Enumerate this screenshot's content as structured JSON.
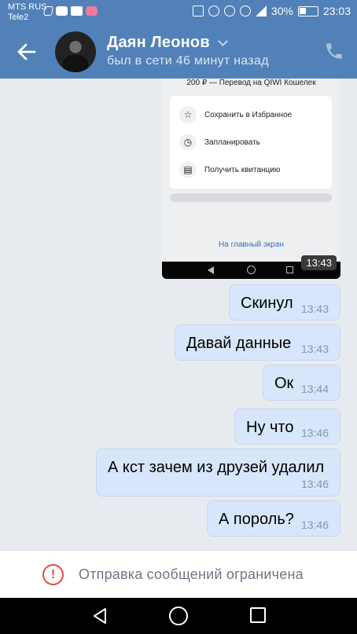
{
  "statusbar": {
    "carrier1": "MTS RUS",
    "carrier2": "Tele2",
    "battery": "30%",
    "time": "23:03"
  },
  "header": {
    "name": "Даян Леонов",
    "last_seen": "был в сети 46 минут назад",
    "back_icon": "arrow-left-icon",
    "call_icon": "phone-icon"
  },
  "screenshot": {
    "title": "200 ₽ — Перевод на QIWI Кошелек",
    "actions": [
      {
        "icon": "star-icon",
        "label": "Сохранить в Избранное"
      },
      {
        "icon": "clock-icon",
        "label": "Запланировать"
      },
      {
        "icon": "receipt-icon",
        "label": "Получить квитанцию"
      }
    ],
    "link": "На главный экран",
    "time": "13:43"
  },
  "messages": [
    {
      "text": "Скинул",
      "time": "13:43"
    },
    {
      "text": "Давай данные",
      "time": "13:43"
    },
    {
      "text": "Ок",
      "time": "13:44"
    },
    {
      "text": "Ну что",
      "time": "13:46"
    },
    {
      "text": "А кст зачем из друзей удалил",
      "time": "13:46"
    },
    {
      "text": "А пороль?",
      "time": "13:46"
    }
  ],
  "restriction": {
    "icon": "warning-icon",
    "text": "Отправка сообщений ограничена"
  },
  "colors": {
    "header": "#5181b8",
    "bubble": "#d7e6fa",
    "warning": "#e64646"
  }
}
